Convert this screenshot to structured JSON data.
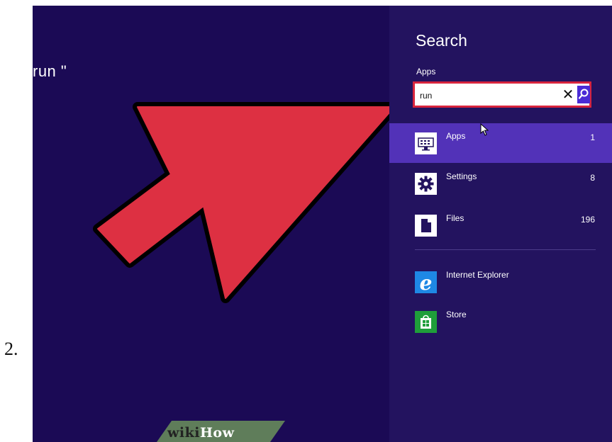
{
  "step": {
    "number": "2."
  },
  "background_hint": {
    "text": "run \""
  },
  "charm": {
    "title": "Search",
    "scope": "Apps",
    "search": {
      "value": "run",
      "clear_glyph": "✕"
    },
    "results": [
      {
        "label": "Apps",
        "count": "1",
        "icon": "keyboard-icon",
        "selected": true
      },
      {
        "label": "Settings",
        "count": "8",
        "icon": "gear-icon",
        "selected": false
      },
      {
        "label": "Files",
        "count": "196",
        "icon": "file-icon",
        "selected": false
      }
    ],
    "suggestions": [
      {
        "label": "Internet Explorer",
        "icon": "internet-explorer-icon"
      },
      {
        "label": "Store",
        "icon": "store-icon"
      }
    ]
  },
  "watermark": {
    "wiki": "wiki",
    "how": "How"
  },
  "colors": {
    "screen_bg": "#1b0a55",
    "charm_bg": "#23135f",
    "selected_row": "#5232b8",
    "search_border": "#d8243d",
    "search_button": "#4a2bd6",
    "arrow_fill": "#dd3042",
    "ie_blue": "#1e88e5",
    "store_green": "#1f9e3a"
  }
}
